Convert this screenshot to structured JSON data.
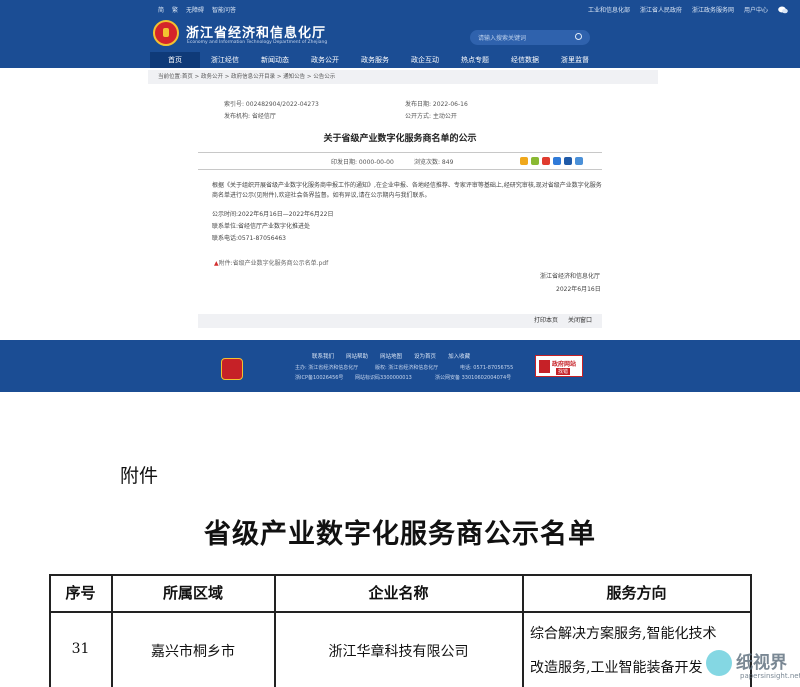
{
  "header": {
    "top_links": [
      "简",
      "繁",
      "无障碍",
      "智能问答"
    ],
    "top_right_links": [
      "工业和信息化部",
      "浙江省人民政府",
      "浙江政务服务网",
      "用户中心"
    ],
    "title": "浙江省经济和信息化厅",
    "subtitle": "Economy and Information Technology Department of Zhejiang",
    "search_placeholder": "请输入搜索关键词"
  },
  "nav": {
    "items": [
      "首页",
      "浙江经信",
      "新闻动态",
      "政务公开",
      "政务服务",
      "政企互动",
      "热点专题",
      "经信数据",
      "浙里监督"
    ]
  },
  "breadcrumb": "当前位置:首页 > 政务公开 > 政府信息公开目录 > 通知公告 > 公告公示",
  "meta": {
    "index_label": "索引号: 002482904/2022-04273",
    "issuer_label": "发布机构: 省经信厅",
    "date_label": "发布日期: 2022-06-16",
    "open_label": "公开方式: 主动公开"
  },
  "doc": {
    "title": "关于省级产业数字化服务商名单的公示",
    "print_date": "印发日期: 0000-00-00",
    "views": "浏览次数: 849",
    "body_1": "根据《关于组织开展省级产业数字化服务商申报工作的通知》,在企业申报、各地经信推荐、专家评审等基础上,经研究审核,现对省级产业数字化服务商名单进行公示(见附件),欢迎社会各界监督。如有异议,请在公示期内与我们联系。",
    "period": "公示时间:2022年6月16日—2022年6月22日",
    "unit": "联系单位:省经信厅产业数字化推进处",
    "phone": "联系电话:0571-87056463",
    "attachment": "附件:省级产业数字化服务商公示名单.pdf",
    "signature": "浙江省经济和信息化厅",
    "sign_date": "2022年6月16日",
    "print_btn": "打印本页",
    "close_btn": "关闭窗口"
  },
  "footer": {
    "links": [
      "联系我们",
      "网站帮助",
      "网站地图",
      "设为首页",
      "加入收藏"
    ],
    "host": "主办: 浙江省经济和信息化厅",
    "copyright": "版权: 浙江省经济和信息化厅",
    "tel": "电话: 0571-87056755",
    "icp": "浙ICP备10026456号",
    "site_code": "网站标识码3300000013",
    "police": "浙公网安备 33010602004074号",
    "gov_badge_title": "政府网站",
    "gov_badge_sub": "找错"
  },
  "attachment_page": {
    "label": "附件",
    "title": "省级产业数字化服务商公示名单",
    "columns": [
      "序号",
      "所属区域",
      "企业名称",
      "服务方向"
    ],
    "rows": [
      {
        "no": "31",
        "region": "嘉兴市桐乡市",
        "company": "浙江华章科技有限公司",
        "direction_1": "综合解决方案服务,智能化技术",
        "direction_2": "改造服务,工业智能装备开发"
      }
    ]
  },
  "watermark": {
    "text": "纸视界",
    "sub": "papersinsight.net"
  },
  "colors": {
    "brand_blue": "#1b4d94",
    "nav_active": "#0f3a78",
    "emblem_red": "#d4242a"
  }
}
